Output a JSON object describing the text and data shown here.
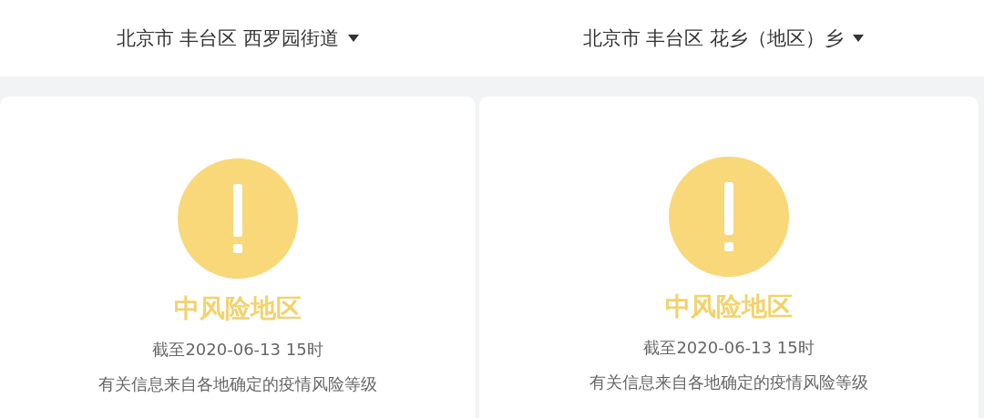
{
  "panels": [
    {
      "location": "北京市 丰台区 西罗园街道",
      "risk_level": "中风险地区",
      "updated": "截至2020-06-13 15时",
      "note": "有关信息来自各地确定的疫情风险等级"
    },
    {
      "location": "北京市 丰台区 花乡（地区）乡",
      "risk_level": "中风险地区",
      "updated": "截至2020-06-13 15时",
      "note": "有关信息来自各地确定的疫情风险等级"
    }
  ]
}
